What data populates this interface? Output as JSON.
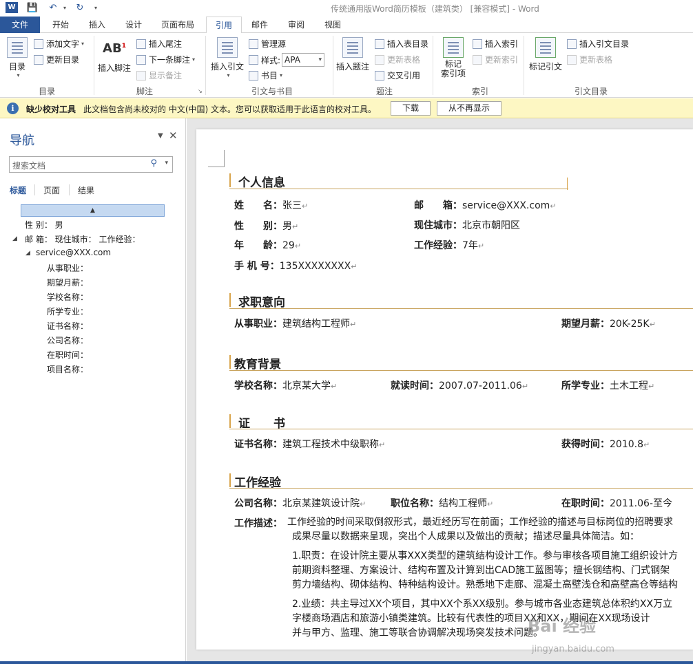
{
  "window": {
    "title": "传统通用版Word简历模板（建筑类） [兼容模式] - Word",
    "app_icon": "W"
  },
  "tabs": [
    "文件",
    "开始",
    "插入",
    "设计",
    "页面布局",
    "引用",
    "邮件",
    "审阅",
    "视图"
  ],
  "ribbon": {
    "toc": {
      "big": "目录",
      "add_text": "添加文字",
      "update": "更新目录",
      "label": "目录"
    },
    "footnote": {
      "big": "插入脚注",
      "insert_endnote": "插入尾注",
      "next": "下一条脚注",
      "show": "显示备注",
      "label": "脚注"
    },
    "citation": {
      "big": "插入引文",
      "manage": "管理源",
      "style_label": "样式:",
      "style_value": "APA",
      "biblio": "书目",
      "label": "引文与书目"
    },
    "caption": {
      "big": "插入题注",
      "insert_table": "插入表目录",
      "update_table": "更新表格",
      "crossref": "交叉引用",
      "label": "题注"
    },
    "index": {
      "big": "标记\n索引项",
      "insert": "插入索引",
      "update": "更新索引",
      "label": "索引"
    },
    "toa": {
      "big": "标记引文",
      "insert": "插入引文目录",
      "update": "更新表格",
      "label": "引文目录"
    }
  },
  "infobar": {
    "bold": "缺少校对工具",
    "text": "此文档包含尚未校对的 中文(中国) 文本。您可以获取适用于此语言的校对工具。",
    "download": "下载",
    "dont_show": "从不再显示"
  },
  "nav": {
    "title": "导航",
    "search_placeholder": "搜索文档",
    "tabs": [
      "标题",
      "页面",
      "结果"
    ],
    "items": [
      "性 别： 男",
      "邮 箱： 现住城市： 工作经验：",
      "service@XXX.com",
      "从事职业：",
      "期望月薪：",
      "学校名称：",
      "所学专业：",
      "证书名称：",
      "公司名称：",
      "在职时间：",
      "项目名称："
    ]
  },
  "doc": {
    "s1": "个人信息",
    "name_k": "姓　　名：",
    "name_v": "张三",
    "email_k": "邮　　箱：",
    "email_v": "service@XXX.com",
    "gender_k": "性　　别：",
    "gender_v": "男",
    "city_k": "现住城市：",
    "city_v": "北京市朝阳区",
    "age_k": "年　　龄：",
    "age_v": "29",
    "exp_k": "工作经验：",
    "exp_v": "7年",
    "phone_k": "手 机 号：",
    "phone_v": "135XXXXXXXX",
    "s2": "求职意向",
    "job_k": "从事职业：",
    "job_v": "建筑结构工程师",
    "salary_k": "期望月薪：",
    "salary_v": "20K-25K",
    "s3": "教育背景",
    "school_k": "学校名称：",
    "school_v": "北京某大学",
    "study_k": "就读时间：",
    "study_v": "2007.07-2011.06",
    "major_k": "所学专业：",
    "major_v": "土木工程",
    "s4": "证　　书",
    "cert_k": "证书名称：",
    "cert_v": "建筑工程技术中级职称",
    "got_k": "获得时间：",
    "got_v": "2010.8",
    "s5": "工作经验",
    "co_k": "公司名称：",
    "co_v": "北京某建筑设计院",
    "pos_k": "职位名称：",
    "pos_v": "结构工程师",
    "time_k": "在职时间：",
    "time_v": "2011.06-至今",
    "desc_k": "工作描述：",
    "desc_1": "工作经验的时间采取倒叙形式，最近经历写在前面；工作经验的描述与目标岗位的招聘要求",
    "desc_2": "成果尽量以数据来呈现，突出个人成果以及做出的贡献；描述尽量具体简洁。如：",
    "p1_1": "1.职责：在设计院主要从事XXX类型的建筑结构设计工作。参与审核各项目施工组织设计方",
    "p1_2": "前期资料整理、方案设计、结构布置及计算到出CAD施工蓝图等；擅长钢结构、门式钢架",
    "p1_3": "剪力墙结构、砌体结构、特种结构设计。熟悉地下走廊、混凝土高壁浅仓和高壁高仓等结构",
    "p2_1": "2.业绩：共主导过XX个项目，其中XX个系XX级别。参与城市各业态建筑总体积约XX万立",
    "p2_2": "字楼商场酒店和旅游小镇类建筑。比较有代表性的项目XX和XX，期间在XX现场设计",
    "p2_3": "并与甲方、监理、施工等联合协调解决现场突发技术问题。"
  },
  "watermark": {
    "text": "Bai 经验",
    "url": "jingyan.baidu.com"
  }
}
